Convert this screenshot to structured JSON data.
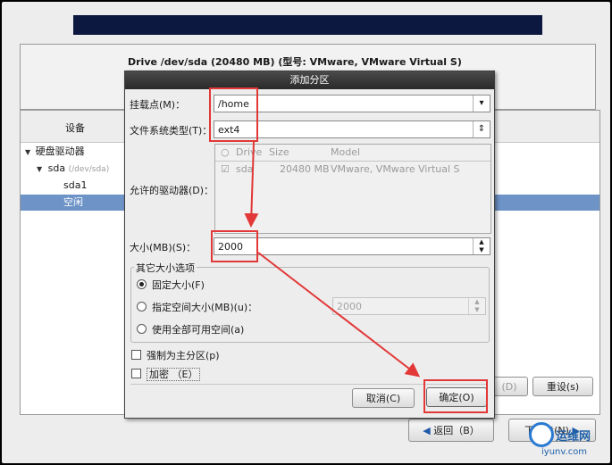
{
  "installer": {
    "drive_title": "Drive /dev/sda (20480 MB) (型号: VMware, VMware Virtual S)",
    "column_device": "设备",
    "tree": [
      {
        "label": "硬盘驱动器",
        "sub": ""
      },
      {
        "label": "sda",
        "sub": "(/dev/sda)"
      },
      {
        "label": "sda1",
        "sub": ""
      },
      {
        "label": "空闲",
        "sub": ""
      }
    ],
    "btn_delete": "(D)",
    "btn_reset": "重设(s)",
    "btn_back": "返回（B）",
    "btn_next": "下一步(N)"
  },
  "dialog": {
    "title": "添加分区",
    "mount_label": "挂载点(M)：",
    "mount_value": "/home",
    "fs_label": "文件系统类型(T)：",
    "fs_value": "ext4",
    "drives_label": "允许的驱动器(D)：",
    "drive_columns": [
      "Drive",
      "Size",
      "Model"
    ],
    "drive_row": {
      "drive": "sda",
      "size": "20480 MB",
      "model": "VMware, VMware Virtual S"
    },
    "size_label": "大小(MB)(S)：",
    "size_value": "2000",
    "options_title": "其它大小选项",
    "opt_fixed": "固定大小(F)",
    "opt_upto": "指定空间大小(MB)(u)：",
    "opt_upto_value": "2000",
    "opt_fill": "使用全部可用空间(a)",
    "force_primary": "强制为主分区(p)",
    "encrypt": "加密 （E）",
    "cancel": "取消(C)",
    "ok": "确定(O)"
  },
  "watermark": {
    "title": "运维网",
    "url": "iyunv.com"
  }
}
